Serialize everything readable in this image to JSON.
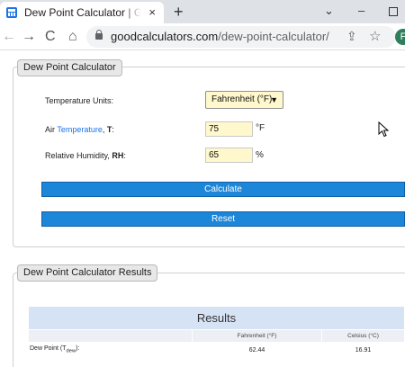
{
  "browser": {
    "tab_title": "Dew Point Calculator | Good Calculators",
    "tab_close": "×",
    "new_tab": "+",
    "url_host": "goodcalculators.com",
    "url_path": "/dew-point-calculator/",
    "profile_initial": "F"
  },
  "calculator": {
    "legend": "Dew Point Calculator",
    "units_label": "Temperature Units:",
    "units_selected": "Fahrenheit (°F)",
    "temp_label_prefix": "Air ",
    "temp_label_link": "Temperature",
    "temp_label_suffix": ", ",
    "temp_label_symbol": "T",
    "temp_label_colon": ":",
    "temp_value": "75",
    "temp_unit": "°F",
    "rh_label": "Relative Humidity, ",
    "rh_label_symbol": "RH",
    "rh_label_colon": ":",
    "rh_value": "65",
    "rh_unit": "%",
    "calculate_label": "Calculate",
    "reset_label": "Reset"
  },
  "results": {
    "legend": "Dew Point Calculator Results",
    "table_title": "Results",
    "columns": [
      "Fahrenheit (°F)",
      "Celsius (°C)"
    ],
    "row_label_prefix": "Dew Point (T",
    "row_label_sub": "dew",
    "row_label_suffix": "):",
    "fahrenheit": "62.44",
    "celsius": "16.91"
  },
  "colors": {
    "button": "#1c86d8",
    "input_bg": "#fff8cc",
    "table_header": "#d6e3f5"
  }
}
